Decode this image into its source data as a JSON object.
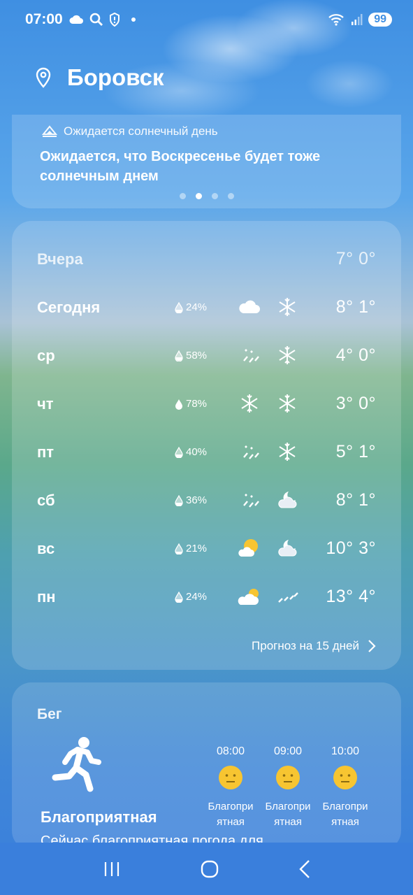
{
  "status_bar": {
    "time": "07:00",
    "battery": "99"
  },
  "header": {
    "city": "Боровск"
  },
  "insight": {
    "tag": "Ожидается солнечный день",
    "text": "Ожидается, что Воскресенье будет тоже солнечным днем",
    "page_count": 4,
    "active_page": 2
  },
  "forecast": {
    "rows": [
      {
        "day": "Вчера",
        "precip": "",
        "icon_day": "",
        "icon_night": "",
        "temps": "7° 0°"
      },
      {
        "day": "Сегодня",
        "precip": "24%",
        "icon_day": "cloud-icon",
        "icon_night": "snowflake-icon",
        "temps": "8° 1°"
      },
      {
        "day": "ср",
        "precip": "58%",
        "icon_day": "sleet-icon",
        "icon_night": "snowflake-icon",
        "temps": "4° 0°"
      },
      {
        "day": "чт",
        "precip": "78%",
        "icon_day": "snowflake-icon",
        "icon_night": "snowflake-icon",
        "temps": "3° 0°"
      },
      {
        "day": "пт",
        "precip": "40%",
        "icon_day": "sleet-icon",
        "icon_night": "snowflake-icon",
        "temps": "5° 1°"
      },
      {
        "day": "сб",
        "precip": "36%",
        "icon_day": "sleet-icon",
        "icon_night": "cloudy-moon-icon",
        "temps": "8° 1°"
      },
      {
        "day": "вс",
        "precip": "21%",
        "icon_day": "sun-cloud-icon",
        "icon_night": "cloudy-moon-icon",
        "temps": "10° 3°"
      },
      {
        "day": "пн",
        "precip": "24%",
        "icon_day": "sun-cloud-icon",
        "icon_night": "rain-icon",
        "temps": "13° 4°"
      }
    ],
    "more_label": "Прогноз на 15 дней"
  },
  "activity": {
    "title": "Бег",
    "status": "Благоприятная",
    "description": "Сейчас благоприятная погода для",
    "slots": [
      {
        "time": "08:00",
        "label_line1": "Благопри",
        "label_line2": "ятная"
      },
      {
        "time": "09:00",
        "label_line1": "Благопри",
        "label_line2": "ятная"
      },
      {
        "time": "10:00",
        "label_line1": "Благопри",
        "label_line2": "ятная"
      }
    ]
  },
  "colors": {
    "accent_face": "#f7c531",
    "navbar": "#3a7fdc"
  }
}
